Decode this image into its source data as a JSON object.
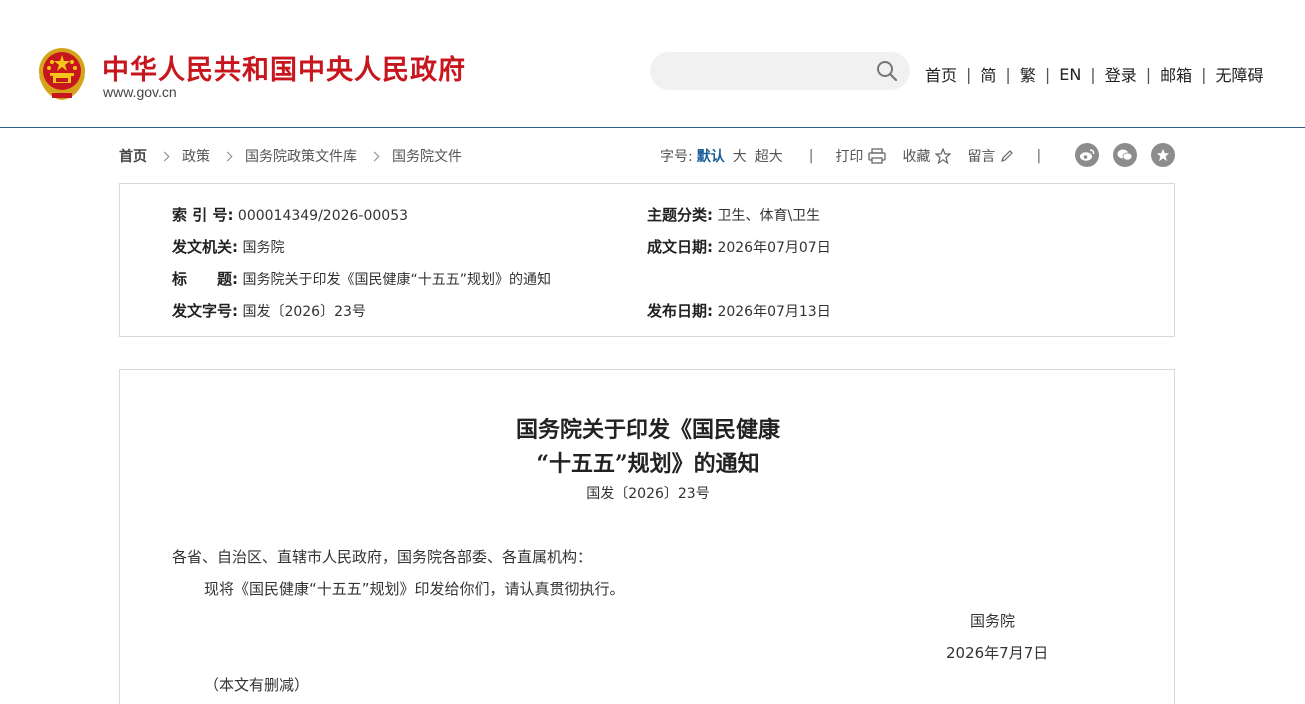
{
  "header": {
    "site_title": "中华人民共和国中央人民政府",
    "site_domain": "www.gov.cn",
    "search_placeholder": "",
    "nav": [
      "首页",
      "简",
      "繁",
      "EN",
      "登录",
      "邮箱",
      "无障碍"
    ],
    "nav_separator": "|"
  },
  "breadcrumb": [
    "首页",
    "政策",
    "国务院政策文件库",
    "国务院文件"
  ],
  "tools": {
    "font_size_label": "字号:",
    "font_sizes": [
      "默认",
      "大",
      "超大"
    ],
    "active_font_size": "默认",
    "separator": "|",
    "print": "打印",
    "favorite": "收藏",
    "comment": "留言",
    "share_icons": [
      "weibo-icon",
      "wechat-icon",
      "star-icon"
    ]
  },
  "meta": {
    "index_no_key": "索 引 号:",
    "index_no": "000014349/2026-00053",
    "category_key": "主题分类:",
    "category": "卫生、体育\\卫生",
    "issuer_key": "发文机关:",
    "issuer": "国务院",
    "written_date_key": "成文日期:",
    "written_date": "2026年07月07日",
    "title_key": "标　　题:",
    "title": "国务院关于印发《国民健康“十五五”规划》的通知",
    "doc_no_key": "发文字号:",
    "doc_no": "国发〔2026〕23号",
    "publish_date_key": "发布日期:",
    "publish_date": "2026年07月13日"
  },
  "article": {
    "title_line1": "国务院关于印发《国民健康",
    "title_line2": "“十五五”规划》的通知",
    "doc_no": "国发〔2026〕23号",
    "salutation": "各省、自治区、直辖市人民政府，国务院各部委、各直属机构：",
    "body": "现将《国民健康“十五五”规划》印发给你们，请认真贯彻执行。",
    "signature": "国务院",
    "date": "2026年7月7日",
    "note": "（本文有删减）"
  },
  "colors": {
    "brand_red": "#c8161e",
    "header_rule": "#2d5c87",
    "active_link": "#1a5d99",
    "share_grey": "#8c8c8c"
  }
}
